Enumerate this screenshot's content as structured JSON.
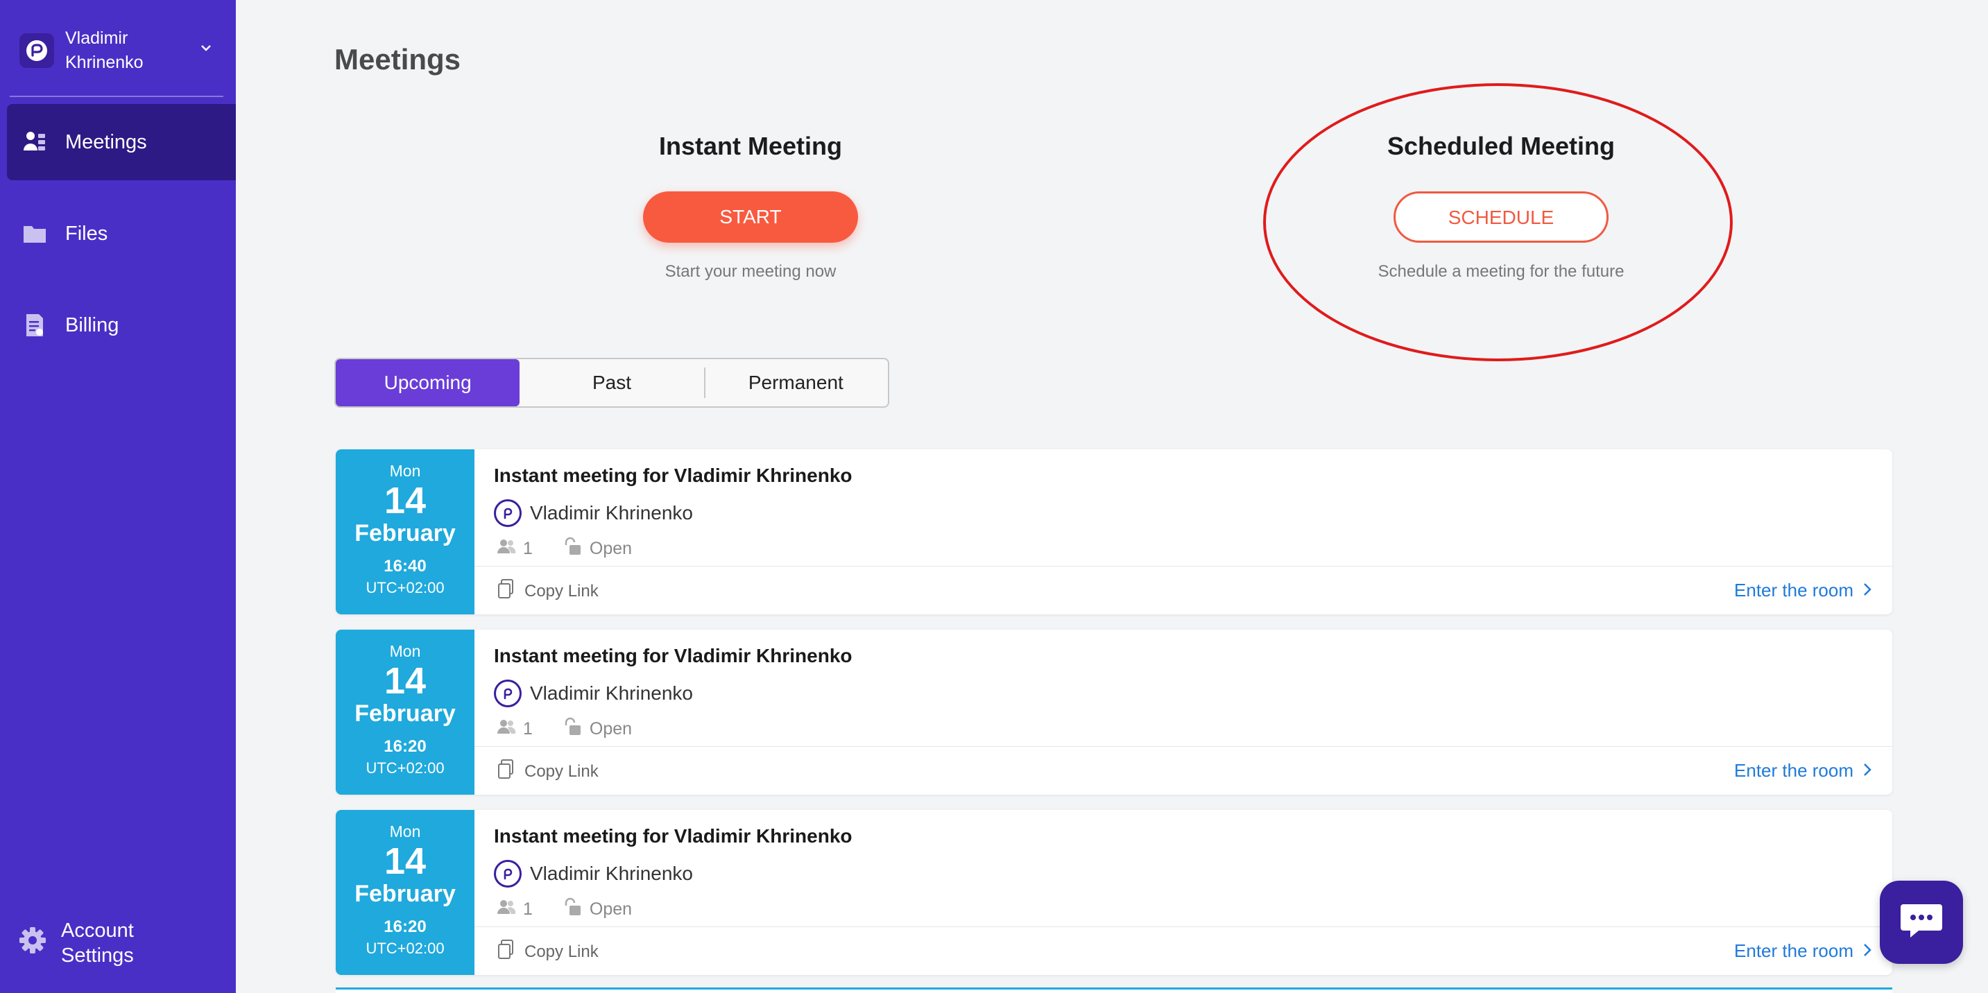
{
  "user": {
    "name": "Vladimir Khrinenko"
  },
  "sidebar": {
    "items": [
      {
        "label": "Meetings",
        "icon": "people-icon",
        "active": true
      },
      {
        "label": "Files",
        "icon": "folder-icon",
        "active": false
      },
      {
        "label": "Billing",
        "icon": "invoice-icon",
        "active": false
      }
    ],
    "settings_label": "Account Settings"
  },
  "page": {
    "title": "Meetings"
  },
  "instant": {
    "heading": "Instant Meeting",
    "button": "START",
    "subtitle": "Start your meeting now"
  },
  "scheduled": {
    "heading": "Scheduled Meeting",
    "button": "SCHEDULE",
    "subtitle": "Schedule a meeting for the future"
  },
  "tabs": [
    {
      "label": "Upcoming",
      "active": true
    },
    {
      "label": "Past",
      "active": false
    },
    {
      "label": "Permanent",
      "active": false
    }
  ],
  "meetings": [
    {
      "dow": "Mon",
      "day": "14",
      "month": "February",
      "time": "16:40",
      "tz": "UTC+02:00",
      "title": "Instant meeting for Vladimir Khrinenko",
      "host": "Vladimir Khrinenko",
      "participants": "1",
      "access": "Open",
      "copy_link": "Copy Link",
      "enter": "Enter the room"
    },
    {
      "dow": "Mon",
      "day": "14",
      "month": "February",
      "time": "16:20",
      "tz": "UTC+02:00",
      "title": "Instant meeting for Vladimir Khrinenko",
      "host": "Vladimir Khrinenko",
      "participants": "1",
      "access": "Open",
      "copy_link": "Copy Link",
      "enter": "Enter the room"
    },
    {
      "dow": "Mon",
      "day": "14",
      "month": "February",
      "time": "16:20",
      "tz": "UTC+02:00",
      "title": "Instant meeting for Vladimir Khrinenko",
      "host": "Vladimir Khrinenko",
      "participants": "1",
      "access": "Open",
      "copy_link": "Copy Link",
      "enter": "Enter the room"
    }
  ],
  "colors": {
    "sidebar": "#4a2fc6",
    "sidebar_active": "#2d1a84",
    "accent_orange": "#f85a40",
    "tab_active": "#6a3dd8",
    "date_box": "#1fa9dc",
    "link_blue": "#1f7ad8",
    "highlight_red": "#e01b1b"
  }
}
